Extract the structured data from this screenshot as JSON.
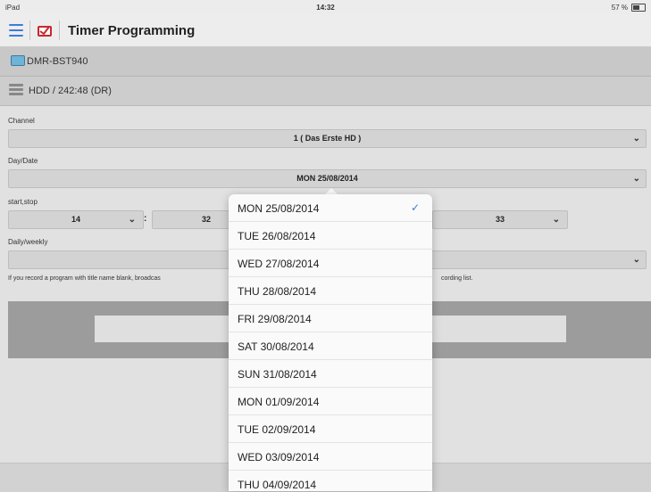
{
  "status_bar": {
    "device": "iPad",
    "time": "14:32",
    "battery": "57 %"
  },
  "nav": {
    "title": "Timer Programming"
  },
  "device": {
    "name": "DMR-BST940"
  },
  "storage": {
    "label": "HDD / 242:48 (DR)"
  },
  "form": {
    "channel_label": "Channel",
    "channel_value": "1 ( Das Erste HD )",
    "date_label": "Day/Date",
    "date_value": "MON 25/08/2014",
    "time_label": "start,stop",
    "start_hour": "14",
    "start_minute": "32",
    "stop_minute": "33",
    "repeat_label": "Daily/weekly",
    "note_left": "If you record a program with title name blank, broadcas",
    "note_right": "cording list."
  },
  "dropdown": {
    "items": [
      {
        "label": "MON 25/08/2014",
        "selected": true
      },
      {
        "label": "TUE 26/08/2014",
        "selected": false
      },
      {
        "label": "WED 27/08/2014",
        "selected": false
      },
      {
        "label": "THU 28/08/2014",
        "selected": false
      },
      {
        "label": "FRI 29/08/2014",
        "selected": false
      },
      {
        "label": "SAT 30/08/2014",
        "selected": false
      },
      {
        "label": "SUN 31/08/2014",
        "selected": false
      },
      {
        "label": "MON 01/09/2014",
        "selected": false
      },
      {
        "label": "TUE 02/09/2014",
        "selected": false
      },
      {
        "label": "WED 03/09/2014",
        "selected": false
      },
      {
        "label": "THU 04/09/2014",
        "selected": false
      }
    ]
  },
  "colors": {
    "accent": "#3b7bd8",
    "band": "#9c9c9c"
  }
}
